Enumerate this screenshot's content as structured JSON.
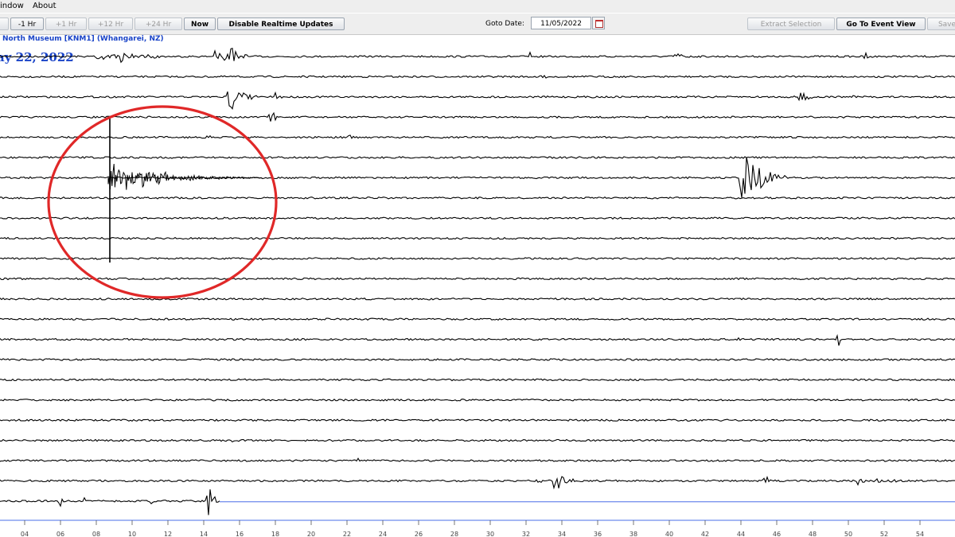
{
  "menu": {
    "items": [
      "indow",
      "About"
    ]
  },
  "toolbar": {
    "buttons": [
      "",
      "-1 Hr",
      "+1 Hr",
      "+12 Hr",
      "+24 Hr",
      "Now",
      "Disable Realtime Updates"
    ],
    "goto_label": "Goto Date:",
    "goto_date": "11/05/2022",
    "right_buttons": [
      "Extract Selection",
      "Go To Event View",
      "Save"
    ]
  },
  "station_label": "North Museum [KNM1] (Whangarei, NZ)",
  "date_title": "ay 22, 2022",
  "seismogram": {
    "trace_count": 23,
    "current_trace_index": 22,
    "highlighted_event": "circled large earthquake near start of trace 7",
    "colors": {
      "trace": "#000000",
      "current_line": "#4a6fe8",
      "circle": "#e02828",
      "title": "#1a44c8"
    }
  },
  "time_axis": {
    "tick_labels": [
      "04",
      "06",
      "08",
      "10",
      "12",
      "14",
      "16",
      "18",
      "20",
      "22",
      "24",
      "26",
      "28",
      "30",
      "32",
      "34",
      "36",
      "38",
      "40",
      "42",
      "44",
      "46",
      "48",
      "50",
      "52",
      "54"
    ]
  }
}
